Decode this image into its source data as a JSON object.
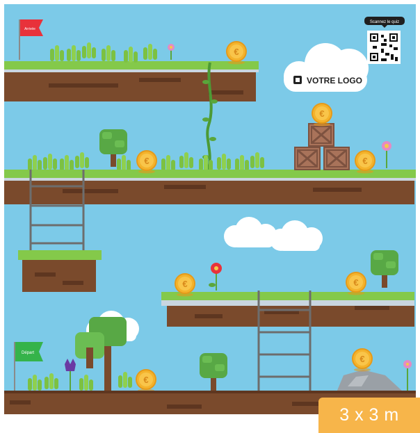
{
  "game": {
    "flags": {
      "finish_label": "Arrivée",
      "start_label": "Départ"
    },
    "qr_caption": "Scannez le quiz",
    "logo_text": "VOTRE LOGO",
    "size_badge": "3 x 3 m",
    "coin_symbol": "€"
  },
  "colors": {
    "sky": "#7ccae8",
    "grass": "#84c94a",
    "dirt": "#7a4a2c",
    "coin": "#f4b32c",
    "finish_flag": "#e8323b",
    "start_flag": "#35b34a",
    "badge": "#f7b54a"
  },
  "icons": {
    "finish_flag": "finish-flag-icon",
    "start_flag": "start-flag-icon",
    "qr": "qr-code-icon",
    "logo": "logo-mark-icon",
    "coin": "euro-coin-icon"
  }
}
